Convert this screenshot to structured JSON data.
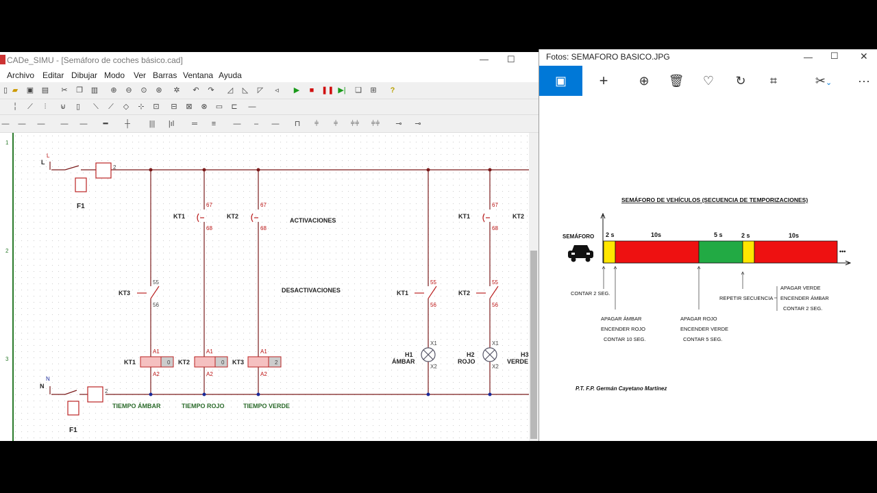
{
  "cad": {
    "title": "CADe_SIMU - [Semáforo de coches básico.cad]",
    "window_min": "—",
    "window_max": "☐",
    "menu": [
      "Archivo",
      "Editar",
      "Dibujar",
      "Modo",
      "Ver",
      "Barras",
      "Ventana",
      "Ayuda"
    ],
    "ruler_marks": [
      "1",
      "2",
      "3"
    ],
    "labels": {
      "L": "L",
      "N": "N",
      "activaciones": "ACTIVACIONES",
      "desactivaciones": "DESACTIVACIONES",
      "kt1": "KT1",
      "kt2": "KT2",
      "kt3": "KT3",
      "n67": "67",
      "n68": "68",
      "n55": "55",
      "n56": "56",
      "a1": "A1",
      "a2": "A2",
      "x1": "X1",
      "x2": "X2",
      "h1": "H1",
      "h2": "H2",
      "h3": "H3",
      "ambar": "ÁMBAR",
      "rojo": "ROJO",
      "verde": "VERDE",
      "t0": "0",
      "t2": "2",
      "tiempo_ambar": "TIEMPO ÁMBAR",
      "tiempo_rojo": "TIEMPO ROJO",
      "tiempo_verde": "TIEMPO VERDE",
      "f1": "F1",
      "dash2": "2"
    }
  },
  "photos": {
    "title": "Fotos: SEMAFORO BASICO.JPG",
    "window_min": "—",
    "window_max": "☐",
    "window_close": "✕",
    "toolbar_more": "···",
    "diagram": {
      "heading": "SEMÁFORO DE VEHÍCULOS (SECUENCIA DE TEMPORIZACIONES)",
      "semaforo": "SEMÁFORO",
      "seg_labels": [
        "2 s",
        "10s",
        "5 s",
        "2 s",
        "10s"
      ],
      "ellipsis": "•••",
      "colors": {
        "yellow": "#ffe600",
        "red": "#ee1111",
        "green": "#22aa44"
      },
      "note1": "CONTAR  2 SEG.",
      "note2": [
        "APAGAR ÁMBAR",
        "ENCENDER ROJO",
        "CONTAR 10 SEG."
      ],
      "note3": [
        "APAGAR ROJO",
        "ENCENDER VERDE",
        "CONTAR 5 SEG."
      ],
      "note4": "REPETIR SECUENCIA",
      "note5": [
        "APAGAR VERDE",
        "ENCENDER ÁMBAR",
        "CONTAR 2 SEG."
      ],
      "author": "P.T. F.P. Germán Cayetano  Martínez"
    }
  }
}
